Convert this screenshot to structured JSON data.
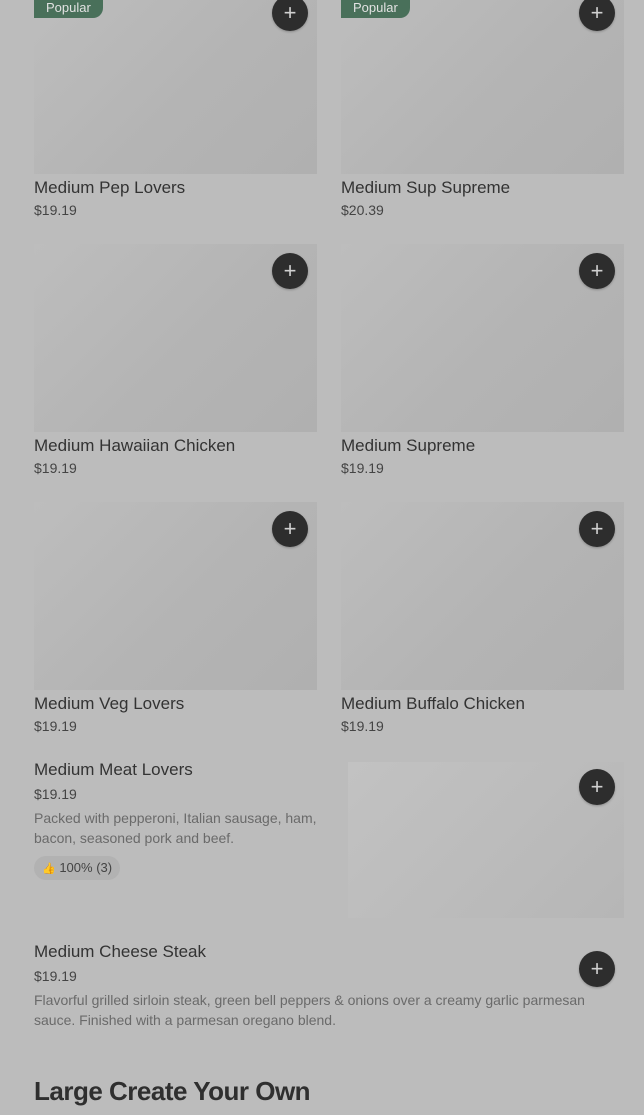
{
  "grid_items": [
    {
      "name": "Medium Pep Lovers",
      "price": "$19.19",
      "badge": "Popular"
    },
    {
      "name": "Medium Sup Supreme",
      "price": "$20.39",
      "badge": "Popular"
    },
    {
      "name": "Medium Hawaiian Chicken",
      "price": "$19.19"
    },
    {
      "name": "Medium Supreme",
      "price": "$19.19"
    },
    {
      "name": "Medium Veg Lovers",
      "price": "$19.19"
    },
    {
      "name": "Medium Buffalo Chicken",
      "price": "$19.19"
    }
  ],
  "list_items": [
    {
      "name": "Medium Meat Lovers",
      "price": "$19.19",
      "description": "Packed with pepperoni, Italian sausage, ham, bacon, seasoned pork and beef.",
      "rating": "100% (3)"
    },
    {
      "name": "Medium Cheese Steak",
      "price": "$19.19",
      "description": "Flavorful grilled sirloin steak, green bell peppers & onions over a creamy garlic parmesan sauce. Finished with a parmesan oregano blend."
    }
  ],
  "add_icon": "+",
  "thumb_icon": "👍",
  "section_title": "Large Create Your Own",
  "colors": {
    "badge": "#49705a",
    "add_button": "#2d2d2d",
    "background": "#bcbcbc"
  }
}
